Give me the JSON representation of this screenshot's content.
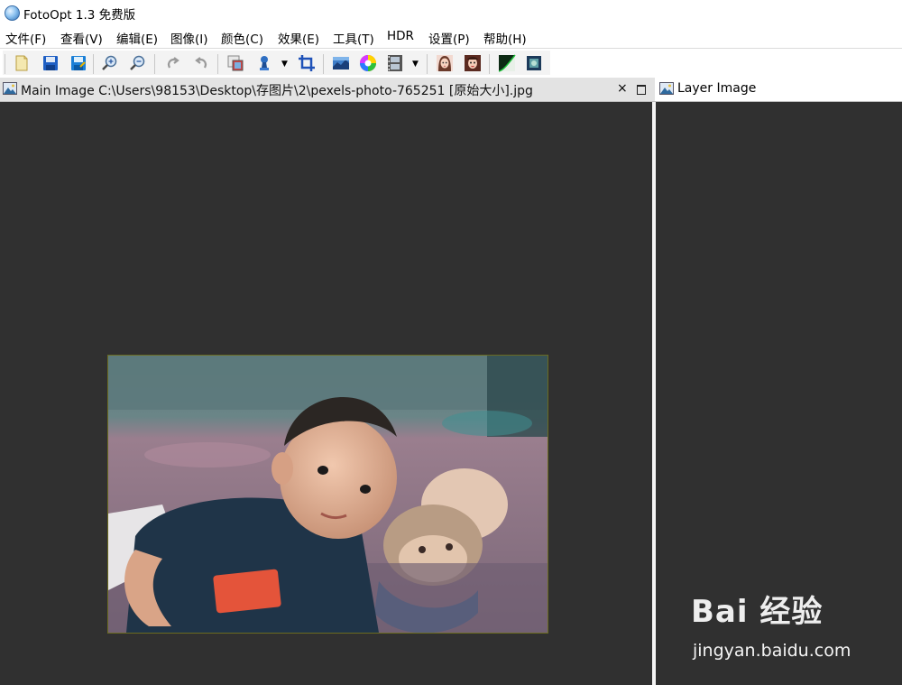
{
  "window": {
    "title": "FotoOpt 1.3 免费版"
  },
  "menu": [
    "文件(F)",
    "查看(V)",
    "编辑(E)",
    "图像(I)",
    "颜色(C)",
    "效果(E)",
    "工具(T)",
    "HDR",
    "设置(P)",
    "帮助(H)"
  ],
  "toolbar": {
    "buttons": [
      "new-icon",
      "save-icon",
      "save-as-icon",
      "zoom-in-icon",
      "zoom-out-icon",
      "undo-icon",
      "redo-icon",
      "resize-icon",
      "stamp-icon",
      "crop-icon",
      "levels-icon",
      "color-wheel-icon",
      "film-icon",
      "portrait-icon",
      "face-icon",
      "curves-icon",
      "blur-icon"
    ],
    "dropdown_arrow": "▼"
  },
  "tabs": {
    "main": {
      "title": "Main Image C:\\Users\\98153\\Desktop\\存图片\\2\\pexels-photo-765251 [原始大小].jpg",
      "close": "×"
    },
    "layer": {
      "title": "Layer Image"
    }
  },
  "watermark": {
    "brand": "Bai 经验",
    "url": "jingyan.baidu.com"
  },
  "colors": {
    "canvas": "#303030",
    "tab_bg": "#e3e3e3",
    "photo_border": "#6b6b20"
  }
}
